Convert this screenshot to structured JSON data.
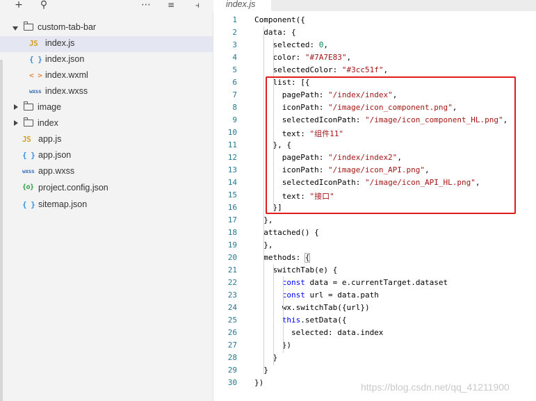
{
  "toolbar": {
    "icons": [
      "add-icon",
      "search-icon",
      "more-icon",
      "collapse-all-icon",
      "split-icon"
    ]
  },
  "explorer": {
    "items": [
      {
        "label": "custom-tab-bar",
        "type": "folder",
        "expanded": true
      },
      {
        "label": "index.js",
        "type": "js",
        "badge": "JS",
        "selected": true
      },
      {
        "label": "index.json",
        "type": "json",
        "badge": "{ }"
      },
      {
        "label": "index.wxml",
        "type": "wxml",
        "badge": "< >"
      },
      {
        "label": "index.wxss",
        "type": "wxss",
        "badge": "wxss"
      },
      {
        "label": "image",
        "type": "folder",
        "expanded": false
      },
      {
        "label": "index",
        "type": "folder",
        "expanded": false
      },
      {
        "label": "app.js",
        "type": "js",
        "badge": "JS"
      },
      {
        "label": "app.json",
        "type": "json",
        "badge": "{ }"
      },
      {
        "label": "app.wxss",
        "type": "wxss",
        "badge": "wxss"
      },
      {
        "label": "project.config.json",
        "type": "cfg",
        "badge": "{o}"
      },
      {
        "label": "sitemap.json",
        "type": "json",
        "badge": "{ }"
      }
    ]
  },
  "editor": {
    "tab_label": "index.js",
    "lines": [
      {
        "n": "1",
        "text": "Component({"
      },
      {
        "n": "2",
        "text": "  data: {"
      },
      {
        "n": "3",
        "text": "    selected: 0,"
      },
      {
        "n": "4",
        "text": "    color: \"#7A7E83\","
      },
      {
        "n": "5",
        "text": "    selectedColor: \"#3cc51f\","
      },
      {
        "n": "6",
        "text": "    list: [{"
      },
      {
        "n": "7",
        "text": "      pagePath: \"/index/index\","
      },
      {
        "n": "8",
        "text": "      iconPath: \"/image/icon_component.png\","
      },
      {
        "n": "9",
        "text": "      selectedIconPath: \"/image/icon_component_HL.png\","
      },
      {
        "n": "10",
        "text": "      text: \"组件11\""
      },
      {
        "n": "11",
        "text": "    }, {"
      },
      {
        "n": "12",
        "text": "      pagePath: \"/index/index2\","
      },
      {
        "n": "13",
        "text": "      iconPath: \"/image/icon_API.png\","
      },
      {
        "n": "14",
        "text": "      selectedIconPath: \"/image/icon_API_HL.png\","
      },
      {
        "n": "15",
        "text": "      text: \"接口\""
      },
      {
        "n": "16",
        "text": "    }]"
      },
      {
        "n": "17",
        "text": "  },"
      },
      {
        "n": "18",
        "text": "  attached() {"
      },
      {
        "n": "19",
        "text": "  },"
      },
      {
        "n": "20",
        "text": "  methods: {"
      },
      {
        "n": "21",
        "text": "    switchTab(e) {"
      },
      {
        "n": "22",
        "text": "      const data = e.currentTarget.dataset"
      },
      {
        "n": "23",
        "text": "      const url = data.path"
      },
      {
        "n": "24",
        "text": "      wx.switchTab({url})"
      },
      {
        "n": "25",
        "text": "      this.setData({"
      },
      {
        "n": "26",
        "text": "        selected: data.index"
      },
      {
        "n": "27",
        "text": "      })"
      },
      {
        "n": "28",
        "text": "    }"
      },
      {
        "n": "29",
        "text": "  }"
      },
      {
        "n": "30",
        "text": "})"
      }
    ]
  },
  "watermark": "https://blog.csdn.net/qq_41211900",
  "colors": {
    "highlight_border": "#e11a1a",
    "line_number": "#237893",
    "string": "#a31515",
    "keyword": "#0000ff",
    "number": "#09885a"
  }
}
